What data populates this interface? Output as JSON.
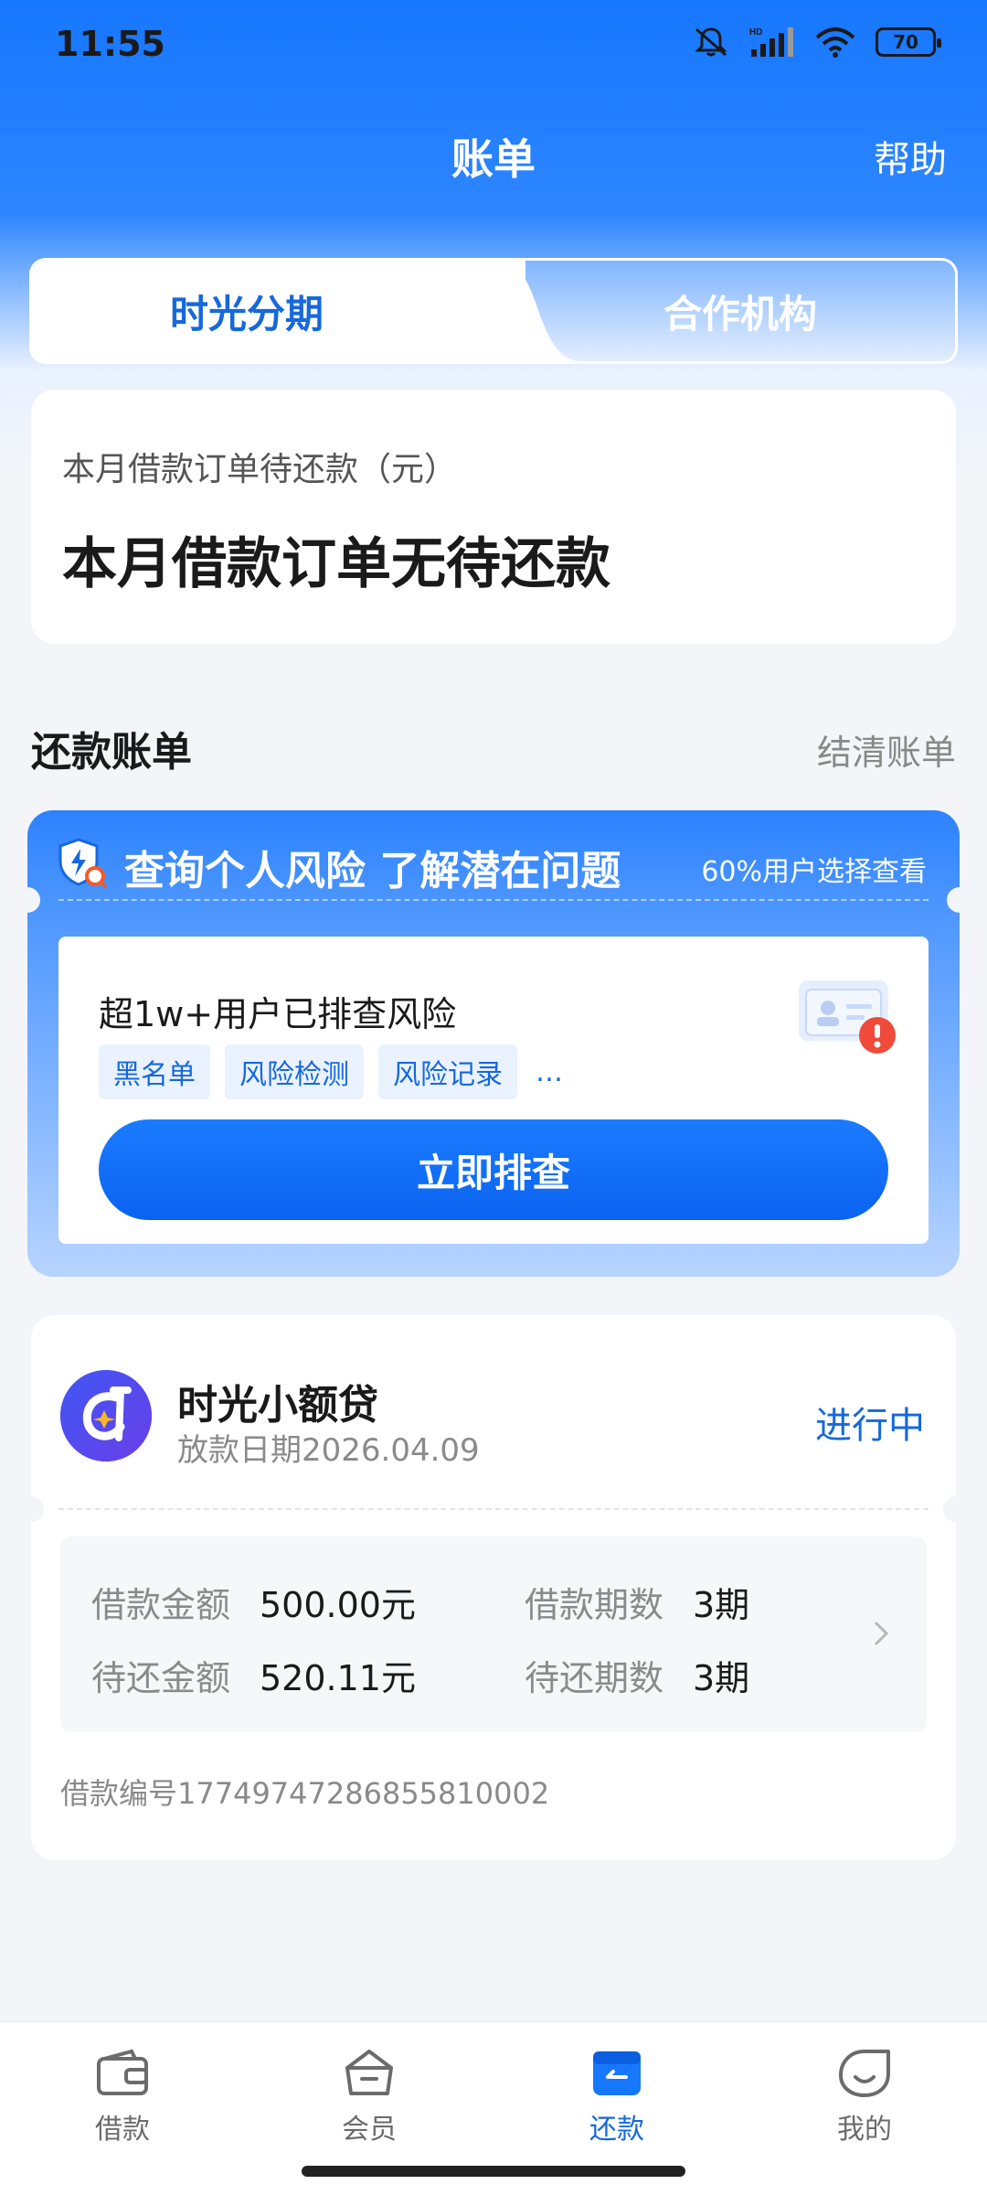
{
  "status_bar": {
    "time": "11:55",
    "battery": "70",
    "icons": [
      "mute-icon",
      "hd-signal-icon",
      "wifi-icon",
      "battery-icon"
    ]
  },
  "header": {
    "title": "账单",
    "help": "帮助"
  },
  "tabs": {
    "active": "时光分期",
    "inactive": "合作机构"
  },
  "summary": {
    "label": "本月借款订单待还款（元）",
    "value": "本月借款订单无待还款"
  },
  "section": {
    "title": "还款账单",
    "link": "结清账单"
  },
  "risk_card": {
    "title": "查询个人风险 了解潜在问题",
    "hint": "60%用户选择查看",
    "inner_title": "超1w+用户已排查风险",
    "tags": [
      "黑名单",
      "风险检测",
      "风险记录"
    ],
    "more": "…",
    "button": "立即排查"
  },
  "loan": {
    "name": "时光小额贷",
    "date": "放款日期2026.04.09",
    "status": "进行中",
    "amount_label": "借款金额",
    "amount_value": "500.00元",
    "periods_label": "借款期数",
    "periods_value": "3期",
    "due_label": "待还金额",
    "due_value": "520.11元",
    "due_periods_label": "待还期数",
    "due_periods_value": "3期",
    "number": "借款编号17749747286855810002"
  },
  "bottom_nav": {
    "items": [
      {
        "label": "借款",
        "icon": "wallet-icon"
      },
      {
        "label": "会员",
        "icon": "basket-icon"
      },
      {
        "label": "还款",
        "icon": "repay-icon"
      },
      {
        "label": "我的",
        "icon": "smile-icon"
      }
    ],
    "active_index": 2
  },
  "colors": {
    "brand": "#1677ff",
    "accent_text": "#1668dc",
    "background": "#f3f5f9"
  }
}
